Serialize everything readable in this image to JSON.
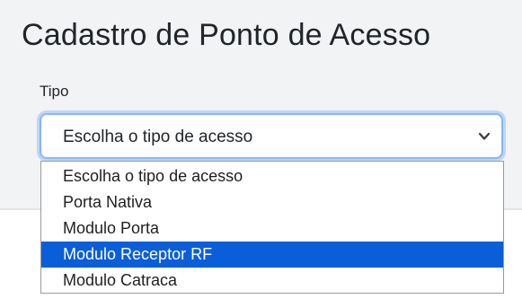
{
  "form": {
    "title": "Cadastro de Ponto de Acesso",
    "tipo_label": "Tipo",
    "select": {
      "value": "Escolha o tipo de acesso",
      "icon": "chevron-down-icon"
    },
    "options": [
      {
        "label": "Escolha o tipo de acesso"
      },
      {
        "label": "Porta Nativa"
      },
      {
        "label": "Modulo Porta"
      },
      {
        "label": "Modulo Receptor RF",
        "highlighted": true
      },
      {
        "label": "Modulo Catraca"
      }
    ]
  },
  "colors": {
    "highlight": "#0a5fd8",
    "focus_border": "#86b7fe",
    "panel_background": "#f2f3f5"
  }
}
